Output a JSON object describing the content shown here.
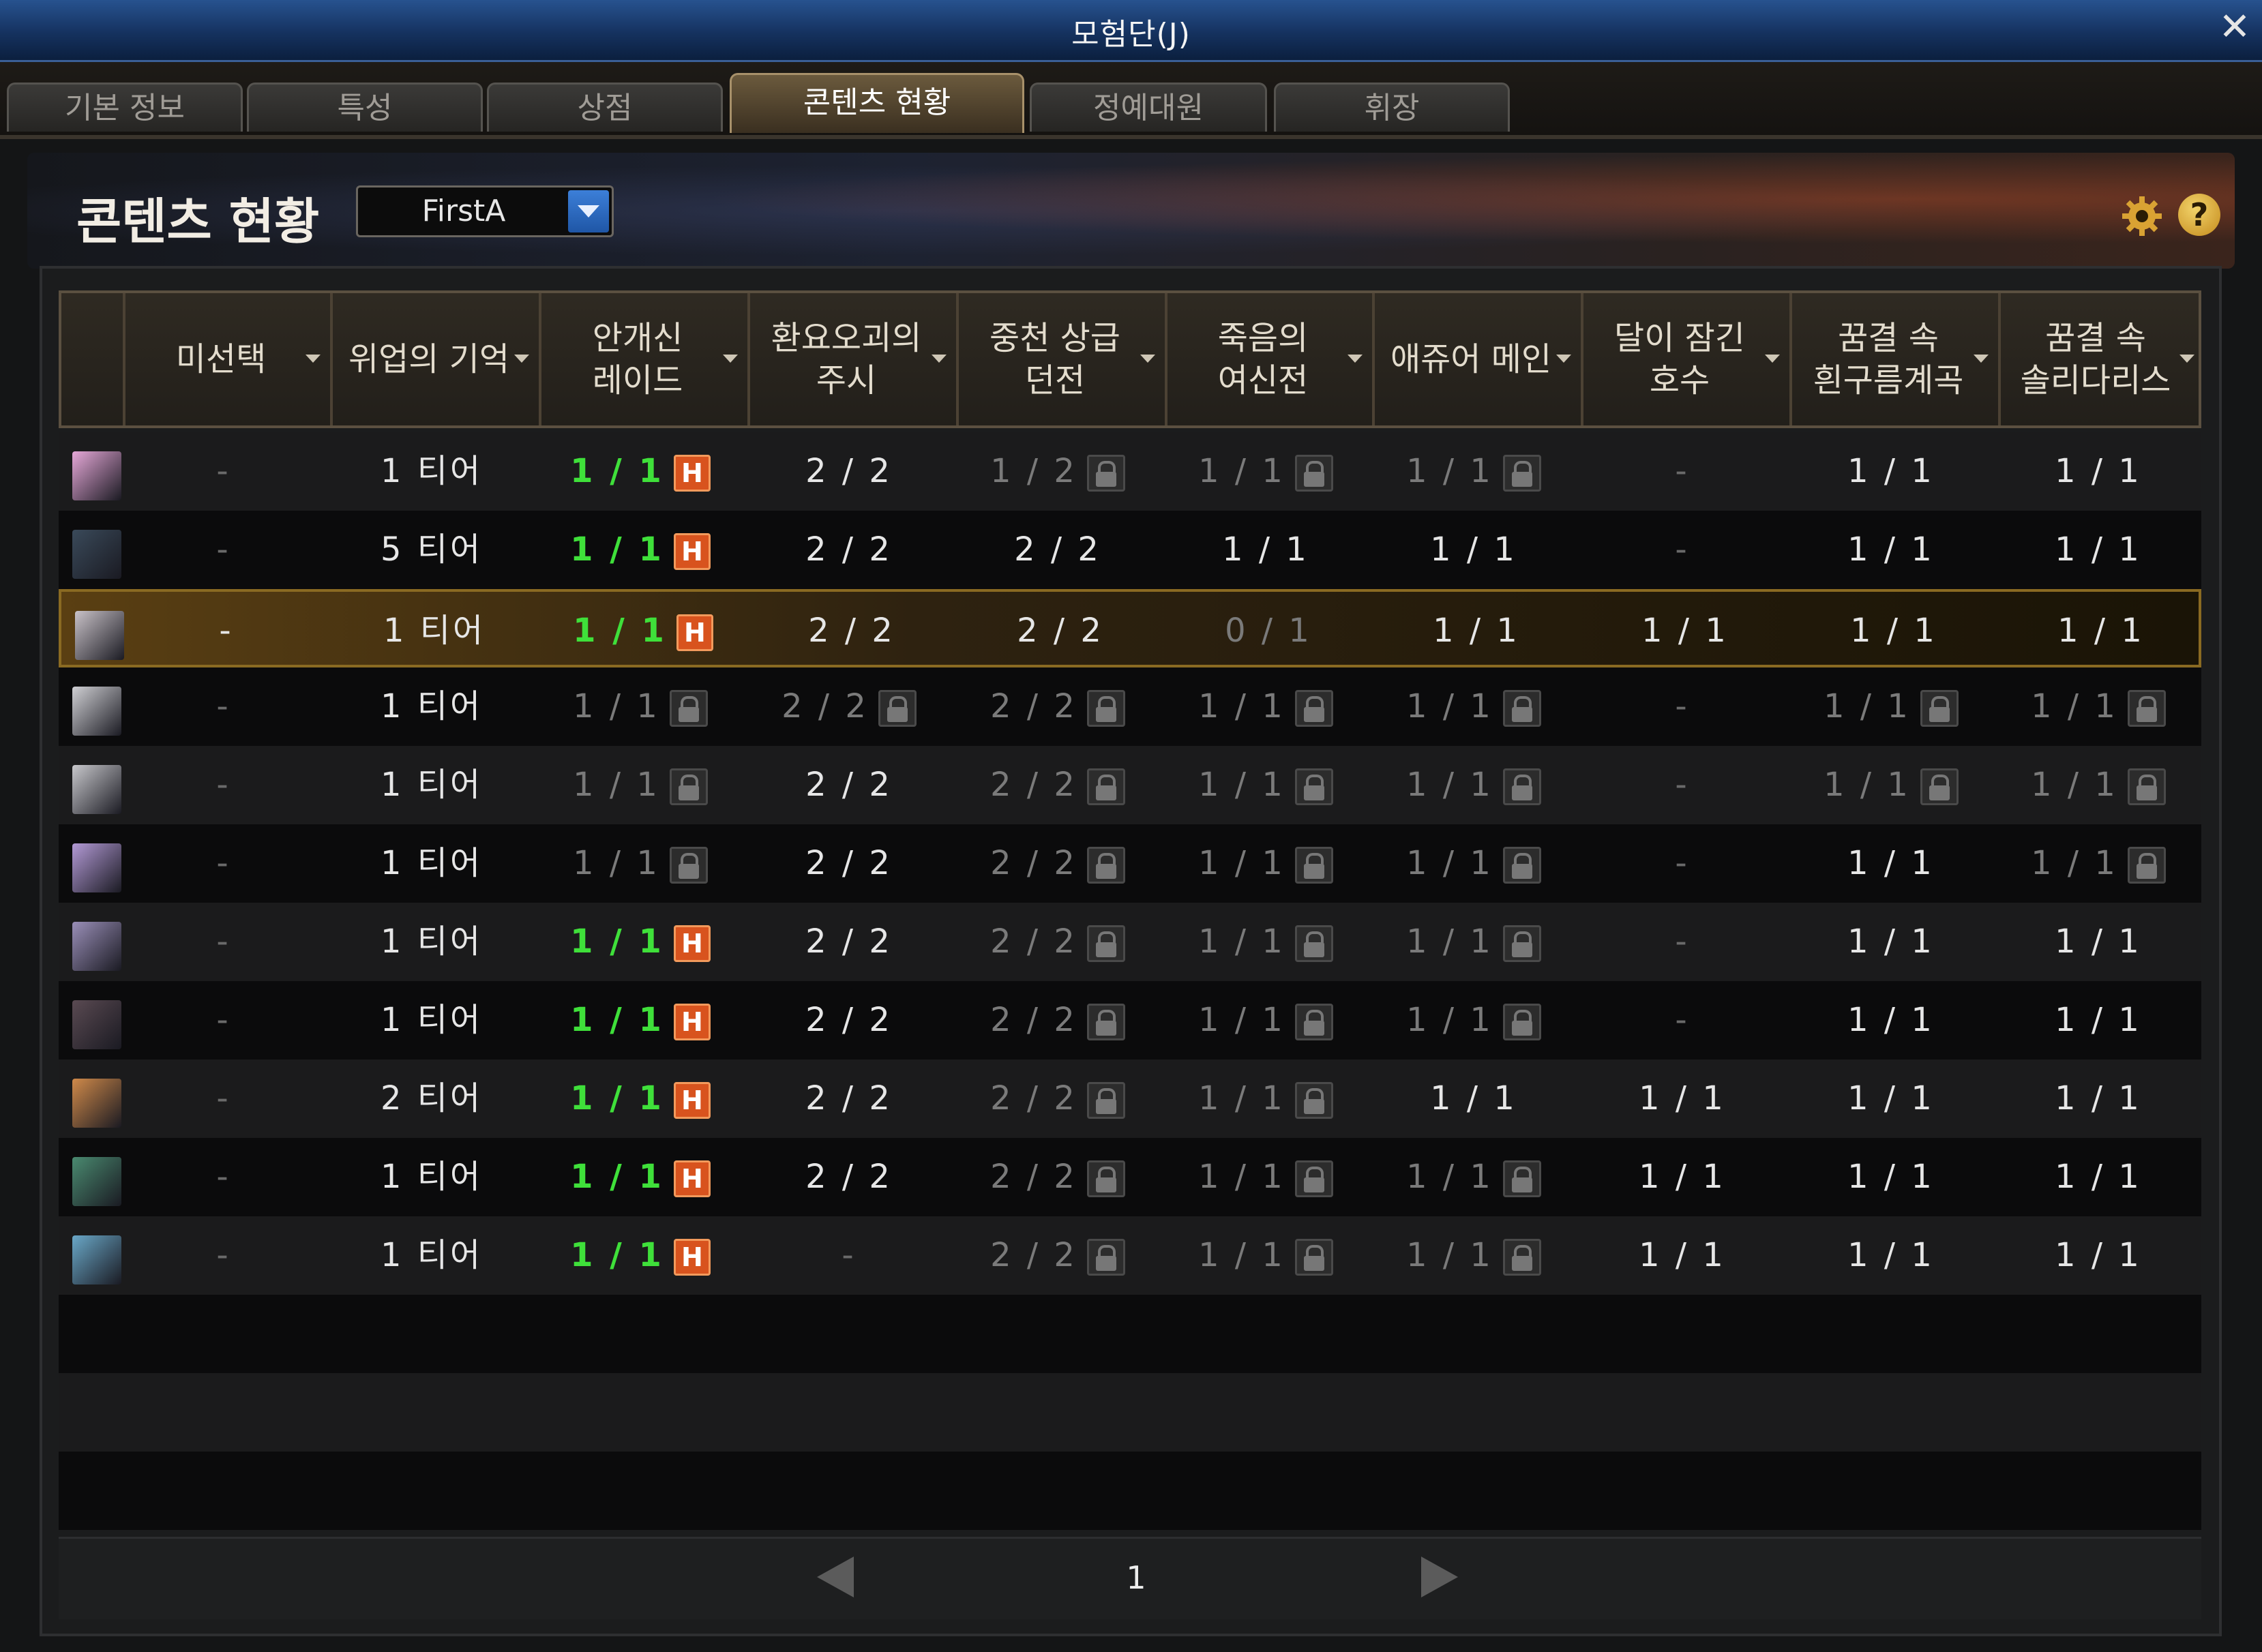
{
  "window": {
    "title": "모험단(J)",
    "close": "✕"
  },
  "tabs": [
    {
      "label": "기본 정보",
      "active": false
    },
    {
      "label": "특성",
      "active": false
    },
    {
      "label": "상점",
      "active": false
    },
    {
      "label": "콘텐츠 현황",
      "active": true
    },
    {
      "label": "정예대원",
      "active": false
    },
    {
      "label": "휘장",
      "active": false
    }
  ],
  "header": {
    "title": "콘텐츠 현황",
    "character_select": "FirstA",
    "help": "?"
  },
  "columns": [
    "",
    "미선택",
    "위업의 기억",
    "안개신\n레이드",
    "환요오괴의\n주시",
    "중천 상급\n던전",
    "죽음의\n여신전",
    "애쥬어 메인",
    "달이 잠긴\n호수",
    "꿈결 속\n흰구름계곡",
    "꿈결 속\n솔리다리스"
  ],
  "rows": [
    {
      "avatar": "#e6a8d8",
      "selected": false,
      "cells": [
        {
          "t": "-",
          "s": "dash"
        },
        {
          "t": "1 티어",
          "s": "white"
        },
        {
          "t": "1 / 1",
          "s": "green",
          "b": "H"
        },
        {
          "t": "2 / 2",
          "s": "white"
        },
        {
          "t": "1 / 2",
          "s": "dim",
          "b": "lock"
        },
        {
          "t": "1 / 1",
          "s": "dim",
          "b": "lock"
        },
        {
          "t": "1 / 1",
          "s": "dim",
          "b": "lock"
        },
        {
          "t": "-",
          "s": "dash"
        },
        {
          "t": "1 / 1",
          "s": "white"
        },
        {
          "t": "1 / 1",
          "s": "white"
        }
      ]
    },
    {
      "avatar": "#3a4a5a",
      "selected": false,
      "cells": [
        {
          "t": "-",
          "s": "dash"
        },
        {
          "t": "5 티어",
          "s": "white"
        },
        {
          "t": "1 / 1",
          "s": "green",
          "b": "H"
        },
        {
          "t": "2 / 2",
          "s": "white"
        },
        {
          "t": "2 / 2",
          "s": "white"
        },
        {
          "t": "1 / 1",
          "s": "white"
        },
        {
          "t": "1 / 1",
          "s": "white"
        },
        {
          "t": "-",
          "s": "dash"
        },
        {
          "t": "1 / 1",
          "s": "white"
        },
        {
          "t": "1 / 1",
          "s": "white"
        }
      ]
    },
    {
      "avatar": "#c9c2c8",
      "selected": true,
      "cells": [
        {
          "t": "-",
          "s": "white"
        },
        {
          "t": "1 티어",
          "s": "white"
        },
        {
          "t": "1 / 1",
          "s": "green",
          "b": "H"
        },
        {
          "t": "2 / 2",
          "s": "white"
        },
        {
          "t": "2 / 2",
          "s": "white"
        },
        {
          "t": "0 / 1",
          "s": "dim"
        },
        {
          "t": "1 / 1",
          "s": "white"
        },
        {
          "t": "1 / 1",
          "s": "white"
        },
        {
          "t": "1 / 1",
          "s": "white"
        },
        {
          "t": "1 / 1",
          "s": "white"
        }
      ]
    },
    {
      "avatar": "#d0d0d4",
      "selected": false,
      "cells": [
        {
          "t": "-",
          "s": "dash"
        },
        {
          "t": "1 티어",
          "s": "white"
        },
        {
          "t": "1 / 1",
          "s": "dim",
          "b": "lock"
        },
        {
          "t": "2 / 2",
          "s": "dim",
          "b": "lock"
        },
        {
          "t": "2 / 2",
          "s": "dim",
          "b": "lock"
        },
        {
          "t": "1 / 1",
          "s": "dim",
          "b": "lock"
        },
        {
          "t": "1 / 1",
          "s": "dim",
          "b": "lock"
        },
        {
          "t": "-",
          "s": "dash"
        },
        {
          "t": "1 / 1",
          "s": "dim",
          "b": "lock"
        },
        {
          "t": "1 / 1",
          "s": "dim",
          "b": "lock"
        }
      ]
    },
    {
      "avatar": "#c8c8cc",
      "selected": false,
      "cells": [
        {
          "t": "-",
          "s": "dash"
        },
        {
          "t": "1 티어",
          "s": "white"
        },
        {
          "t": "1 / 1",
          "s": "dim",
          "b": "lock"
        },
        {
          "t": "2 / 2",
          "s": "white"
        },
        {
          "t": "2 / 2",
          "s": "dim",
          "b": "lock"
        },
        {
          "t": "1 / 1",
          "s": "dim",
          "b": "lock"
        },
        {
          "t": "1 / 1",
          "s": "dim",
          "b": "lock"
        },
        {
          "t": "-",
          "s": "dash"
        },
        {
          "t": "1 / 1",
          "s": "dim",
          "b": "lock"
        },
        {
          "t": "1 / 1",
          "s": "dim",
          "b": "lock"
        }
      ]
    },
    {
      "avatar": "#b39ad6",
      "selected": false,
      "cells": [
        {
          "t": "-",
          "s": "dash"
        },
        {
          "t": "1 티어",
          "s": "white"
        },
        {
          "t": "1 / 1",
          "s": "dim",
          "b": "lock"
        },
        {
          "t": "2 / 2",
          "s": "white"
        },
        {
          "t": "2 / 2",
          "s": "dim",
          "b": "lock"
        },
        {
          "t": "1 / 1",
          "s": "dim",
          "b": "lock"
        },
        {
          "t": "1 / 1",
          "s": "dim",
          "b": "lock"
        },
        {
          "t": "-",
          "s": "dash"
        },
        {
          "t": "1 / 1",
          "s": "white"
        },
        {
          "t": "1 / 1",
          "s": "dim",
          "b": "lock"
        }
      ]
    },
    {
      "avatar": "#9a8fb8",
      "selected": false,
      "cells": [
        {
          "t": "-",
          "s": "dash"
        },
        {
          "t": "1 티어",
          "s": "white"
        },
        {
          "t": "1 / 1",
          "s": "green",
          "b": "H"
        },
        {
          "t": "2 / 2",
          "s": "white"
        },
        {
          "t": "2 / 2",
          "s": "dim",
          "b": "lock"
        },
        {
          "t": "1 / 1",
          "s": "dim",
          "b": "lock"
        },
        {
          "t": "1 / 1",
          "s": "dim",
          "b": "lock"
        },
        {
          "t": "-",
          "s": "dash"
        },
        {
          "t": "1 / 1",
          "s": "white"
        },
        {
          "t": "1 / 1",
          "s": "white"
        }
      ]
    },
    {
      "avatar": "#5a4a52",
      "selected": false,
      "cells": [
        {
          "t": "-",
          "s": "dash"
        },
        {
          "t": "1 티어",
          "s": "white"
        },
        {
          "t": "1 / 1",
          "s": "green",
          "b": "H"
        },
        {
          "t": "2 / 2",
          "s": "white"
        },
        {
          "t": "2 / 2",
          "s": "dim",
          "b": "lock"
        },
        {
          "t": "1 / 1",
          "s": "dim",
          "b": "lock"
        },
        {
          "t": "1 / 1",
          "s": "dim",
          "b": "lock"
        },
        {
          "t": "-",
          "s": "dash"
        },
        {
          "t": "1 / 1",
          "s": "white"
        },
        {
          "t": "1 / 1",
          "s": "white"
        }
      ]
    },
    {
      "avatar": "#d08a4a",
      "selected": false,
      "cells": [
        {
          "t": "-",
          "s": "dash"
        },
        {
          "t": "2 티어",
          "s": "white"
        },
        {
          "t": "1 / 1",
          "s": "green",
          "b": "H"
        },
        {
          "t": "2 / 2",
          "s": "white"
        },
        {
          "t": "2 / 2",
          "s": "dim",
          "b": "lock"
        },
        {
          "t": "1 / 1",
          "s": "dim",
          "b": "lock"
        },
        {
          "t": "1 / 1",
          "s": "white"
        },
        {
          "t": "1 / 1",
          "s": "white"
        },
        {
          "t": "1 / 1",
          "s": "white"
        },
        {
          "t": "1 / 1",
          "s": "white"
        }
      ]
    },
    {
      "avatar": "#4a8a70",
      "selected": false,
      "cells": [
        {
          "t": "-",
          "s": "dash"
        },
        {
          "t": "1 티어",
          "s": "white"
        },
        {
          "t": "1 / 1",
          "s": "green",
          "b": "H"
        },
        {
          "t": "2 / 2",
          "s": "white"
        },
        {
          "t": "2 / 2",
          "s": "dim",
          "b": "lock"
        },
        {
          "t": "1 / 1",
          "s": "dim",
          "b": "lock"
        },
        {
          "t": "1 / 1",
          "s": "dim",
          "b": "lock"
        },
        {
          "t": "1 / 1",
          "s": "white"
        },
        {
          "t": "1 / 1",
          "s": "white"
        },
        {
          "t": "1 / 1",
          "s": "white"
        }
      ]
    },
    {
      "avatar": "#6aa8c8",
      "selected": false,
      "cells": [
        {
          "t": "-",
          "s": "dash"
        },
        {
          "t": "1 티어",
          "s": "white"
        },
        {
          "t": "1 / 1",
          "s": "green",
          "b": "H"
        },
        {
          "t": "-",
          "s": "dash"
        },
        {
          "t": "2 / 2",
          "s": "dim",
          "b": "lock"
        },
        {
          "t": "1 / 1",
          "s": "dim",
          "b": "lock"
        },
        {
          "t": "1 / 1",
          "s": "dim",
          "b": "lock"
        },
        {
          "t": "1 / 1",
          "s": "white"
        },
        {
          "t": "1 / 1",
          "s": "white"
        },
        {
          "t": "1 / 1",
          "s": "white"
        }
      ]
    }
  ],
  "pagination": {
    "page": "1"
  },
  "colors": {
    "accent_green": "#3fe03a",
    "hard_badge": "#d8531e",
    "title_bar": "#15325f",
    "selected_row": "#8a6a22"
  }
}
